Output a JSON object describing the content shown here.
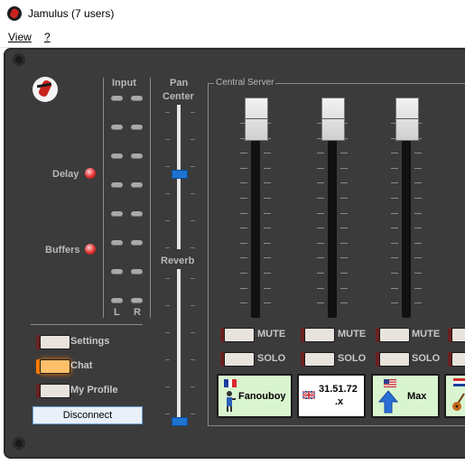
{
  "window": {
    "title": "Jamulus (7 users)"
  },
  "menu": {
    "items": [
      {
        "label": "View"
      },
      {
        "label": "?"
      }
    ]
  },
  "meters": {
    "input_label": "Input",
    "left_label": "L",
    "right_label": "R"
  },
  "indicators": {
    "delay_label": "Delay",
    "buffers_label": "Buffers"
  },
  "controls": {
    "settings_label": "Settings",
    "chat_label": "Chat",
    "profile_label": "My Profile",
    "disconnect_label": "Disconnect"
  },
  "pan": {
    "label": "Pan",
    "value_label": "Center",
    "level": 0.5
  },
  "reverb": {
    "label": "Reverb",
    "level": 0
  },
  "server": {
    "group_label": "Central Server",
    "mute_label": "MUTE",
    "solo_label": "SOLO",
    "channels": [
      {
        "name": "Fanouboy",
        "flag": "france-flag",
        "icon": "singer-icon",
        "color": "#d9f5cf"
      },
      {
        "name_line1": "31.51.72",
        "name_line2": ".x",
        "flag": "uk-flag",
        "icon": "",
        "color": "#ffffff"
      },
      {
        "name": "Max",
        "flag": "usa-flag",
        "icon": "arrow-up-icon",
        "color": "#d9f5cf"
      },
      {
        "name": "",
        "flag": "croatia-flag",
        "icon": "guitar-icon",
        "color": "#d9f5cf"
      }
    ]
  }
}
